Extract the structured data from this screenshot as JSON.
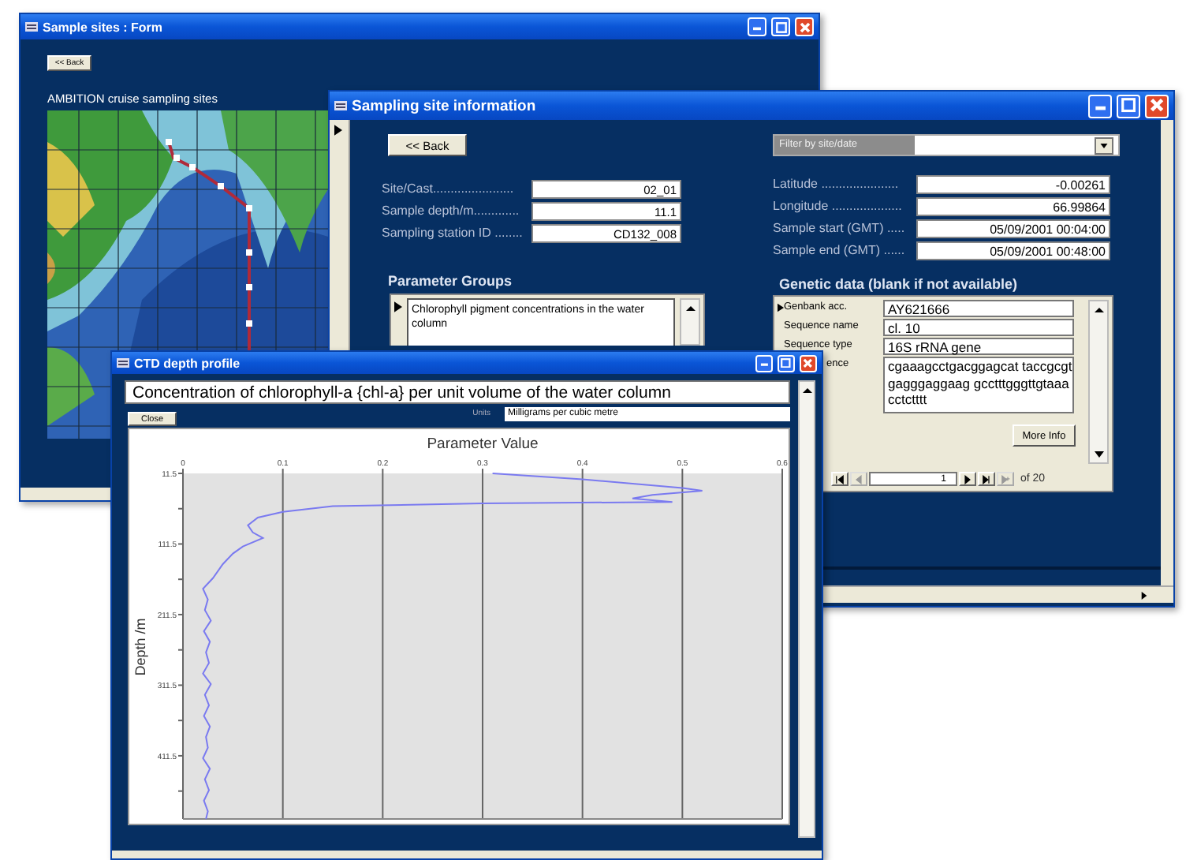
{
  "sites_form": {
    "title": "Sample sites : Form",
    "back_button": "<< Back",
    "heading": "AMBITION cruise sampling sites"
  },
  "site_info": {
    "title": "Sampling site information",
    "back_button": "<< Back",
    "fields": [
      {
        "label": "Site/Cast.......................",
        "value": "02_01"
      },
      {
        "label": "Sample depth/m.............",
        "value": "11.1"
      },
      {
        "label": "Sampling station ID ........",
        "value": "CD132_008"
      }
    ],
    "parameter_groups": {
      "heading": "Parameter Groups",
      "items": [
        "Chlorophyll pigment concentrations in the water column"
      ]
    },
    "filter": {
      "label": "Filter by site/date"
    },
    "position_fields": [
      {
        "label": "Latitude ......................",
        "value": "-0.00261"
      },
      {
        "label": "Longitude ....................",
        "value": "66.99864"
      },
      {
        "label": "Sample start (GMT) .....",
        "value": "05/09/2001 00:04:00"
      },
      {
        "label": "Sample end (GMT) ......",
        "value": "05/09/2001 00:48:00"
      }
    ],
    "genetic": {
      "heading": "Genetic data (blank if not available)",
      "rows": [
        {
          "kind": "line",
          "label": "Genbank acc.",
          "value": "AY621666"
        },
        {
          "kind": "line",
          "label": "Sequence name",
          "value": "cl. 10"
        },
        {
          "kind": "line",
          "label": "Sequence type",
          "value": "16S rRNA gene"
        },
        {
          "kind": "multiline",
          "label": "ence",
          "value": "cgaaagcctgacggagcat taccgcgtgagggaggaag gcctttgggttgtaaacctctttt"
        }
      ],
      "more_button": "More Info",
      "nav": [
        {
          "kind": "first",
          "disabled": false
        },
        {
          "kind": "prev",
          "disabled": true
        }
      ],
      "record": "1",
      "nav_after": [
        {
          "kind": "next",
          "disabled": false
        },
        {
          "kind": "last",
          "disabled": false
        },
        {
          "kind": "new",
          "disabled": true
        }
      ],
      "record_total": "of 20"
    }
  },
  "ctd": {
    "title": "CTD depth profile",
    "parameter": "Concentration of chlorophyll-a {chl-a} per unit volume of the water column",
    "close_button": "Close",
    "units_label": "Units",
    "units": "Milligrams per cubic metre",
    "chart_data": {
      "type": "line",
      "orientation": "horizontal",
      "grid": true,
      "title": "Parameter Value",
      "ylabel": "Depth /m",
      "xlim": [
        0,
        0.6
      ],
      "ylim": [
        501,
        11.5
      ],
      "xticks": [
        0,
        0.1,
        0.2,
        0.3,
        0.4,
        0.5,
        0.6
      ],
      "yticks": [
        11.5,
        111.5,
        211.5,
        311.5,
        411.5
      ],
      "x": [
        11.5,
        20,
        32,
        36,
        42,
        47,
        52,
        54,
        58,
        66,
        74,
        85,
        95,
        103,
        115,
        125,
        140,
        160,
        175,
        190,
        205,
        220,
        235,
        250,
        265,
        280,
        295,
        310,
        325,
        340,
        355,
        370,
        385,
        400,
        415,
        430,
        445,
        460,
        475,
        490,
        501
      ],
      "series": [
        {
          "color": "#7a7af0",
          "values": [
            0.31,
            0.4,
            0.5,
            0.52,
            0.47,
            0.45,
            0.49,
            0.3,
            0.15,
            0.1,
            0.075,
            0.065,
            0.07,
            0.08,
            0.06,
            0.05,
            0.04,
            0.03,
            0.02,
            0.025,
            0.022,
            0.028,
            0.021,
            0.027,
            0.023,
            0.026,
            0.02,
            0.028,
            0.022,
            0.026,
            0.021,
            0.027,
            0.023,
            0.025,
            0.02,
            0.027,
            0.022,
            0.026,
            0.021,
            0.025,
            0.023
          ]
        }
      ]
    }
  }
}
